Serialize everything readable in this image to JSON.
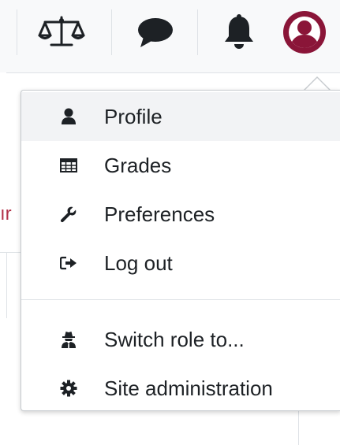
{
  "navbar": {
    "icons": [
      {
        "name": "balance-scale-icon",
        "label": ""
      },
      {
        "name": "comment-icon",
        "label": ""
      },
      {
        "name": "bell-icon",
        "label": ""
      },
      {
        "name": "user-avatar-icon",
        "label": ""
      }
    ],
    "accent_color": "#8a1538"
  },
  "user_menu": {
    "items": [
      {
        "label": "Profile",
        "icon": "user-icon"
      },
      {
        "label": "Grades",
        "icon": "table-icon"
      },
      {
        "label": "Preferences",
        "icon": "wrench-icon"
      },
      {
        "label": "Log out",
        "icon": "sign-out-icon"
      }
    ],
    "secondary_items": [
      {
        "label": "Switch role to...",
        "icon": "user-secret-icon"
      },
      {
        "label": "Site administration",
        "icon": "gear-icon"
      }
    ]
  },
  "background": {
    "partial_link_text": "ır",
    "link_color": "#b3334a"
  }
}
